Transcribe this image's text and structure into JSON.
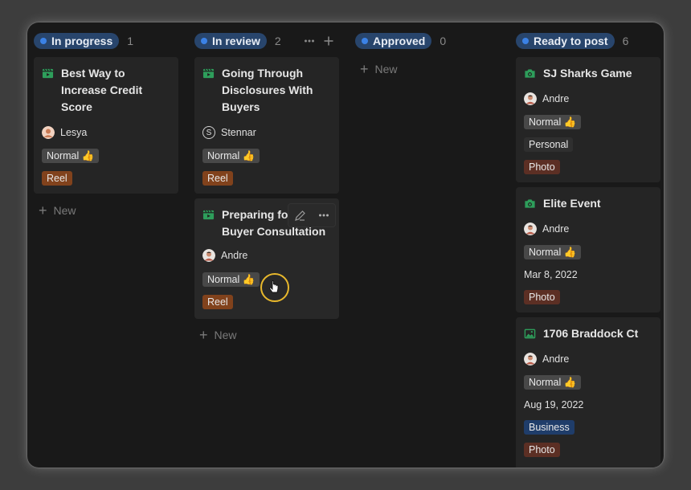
{
  "columns": [
    {
      "status": "In progress",
      "count": "1",
      "new_label": "New",
      "cards": [
        {
          "title": "Best Way to Increase Credit Score",
          "assignee": "Lesya",
          "priority": "Normal 👍",
          "type": "Reel",
          "icon": "video-icon"
        }
      ]
    },
    {
      "status": "In review",
      "count": "2",
      "new_label": "New",
      "cards": [
        {
          "title": "Going Through Disclosures With Buyers",
          "assignee": "Stennar",
          "assignee_initial": "S",
          "priority": "Normal 👍",
          "type": "Reel",
          "icon": "video-icon"
        },
        {
          "title": "Preparing for Buyer Consultation",
          "title_visible": "Preparing for",
          "title_line2": "Buyer Consultation",
          "assignee": "Andre",
          "priority": "Normal 👍",
          "type": "Reel",
          "icon": "video-icon"
        }
      ]
    },
    {
      "status": "Approved",
      "count": "0",
      "new_label": "New",
      "cards": []
    },
    {
      "status": "Ready to post",
      "count": "6",
      "cards": [
        {
          "title": "SJ Sharks Game",
          "assignee": "Andre",
          "priority": "Normal 👍",
          "category": "Personal",
          "type": "Photo",
          "icon": "camera-icon"
        },
        {
          "title": "Elite Event",
          "assignee": "Andre",
          "priority": "Normal 👍",
          "date": "Mar 8, 2022",
          "type": "Photo",
          "icon": "camera-icon"
        },
        {
          "title": "1706 Braddock Ct",
          "assignee": "Andre",
          "priority": "Normal 👍",
          "date": "Aug 19, 2022",
          "category": "Business",
          "type": "Photo",
          "icon": "image-icon"
        }
      ]
    }
  ],
  "colors": {
    "status_pill": "#28456c",
    "status_dot": "#3b82e6",
    "icon_green": "#2e9e5b",
    "reel": "#81421c",
    "photo": "#5c2f24",
    "business": "#1f3d6a"
  }
}
